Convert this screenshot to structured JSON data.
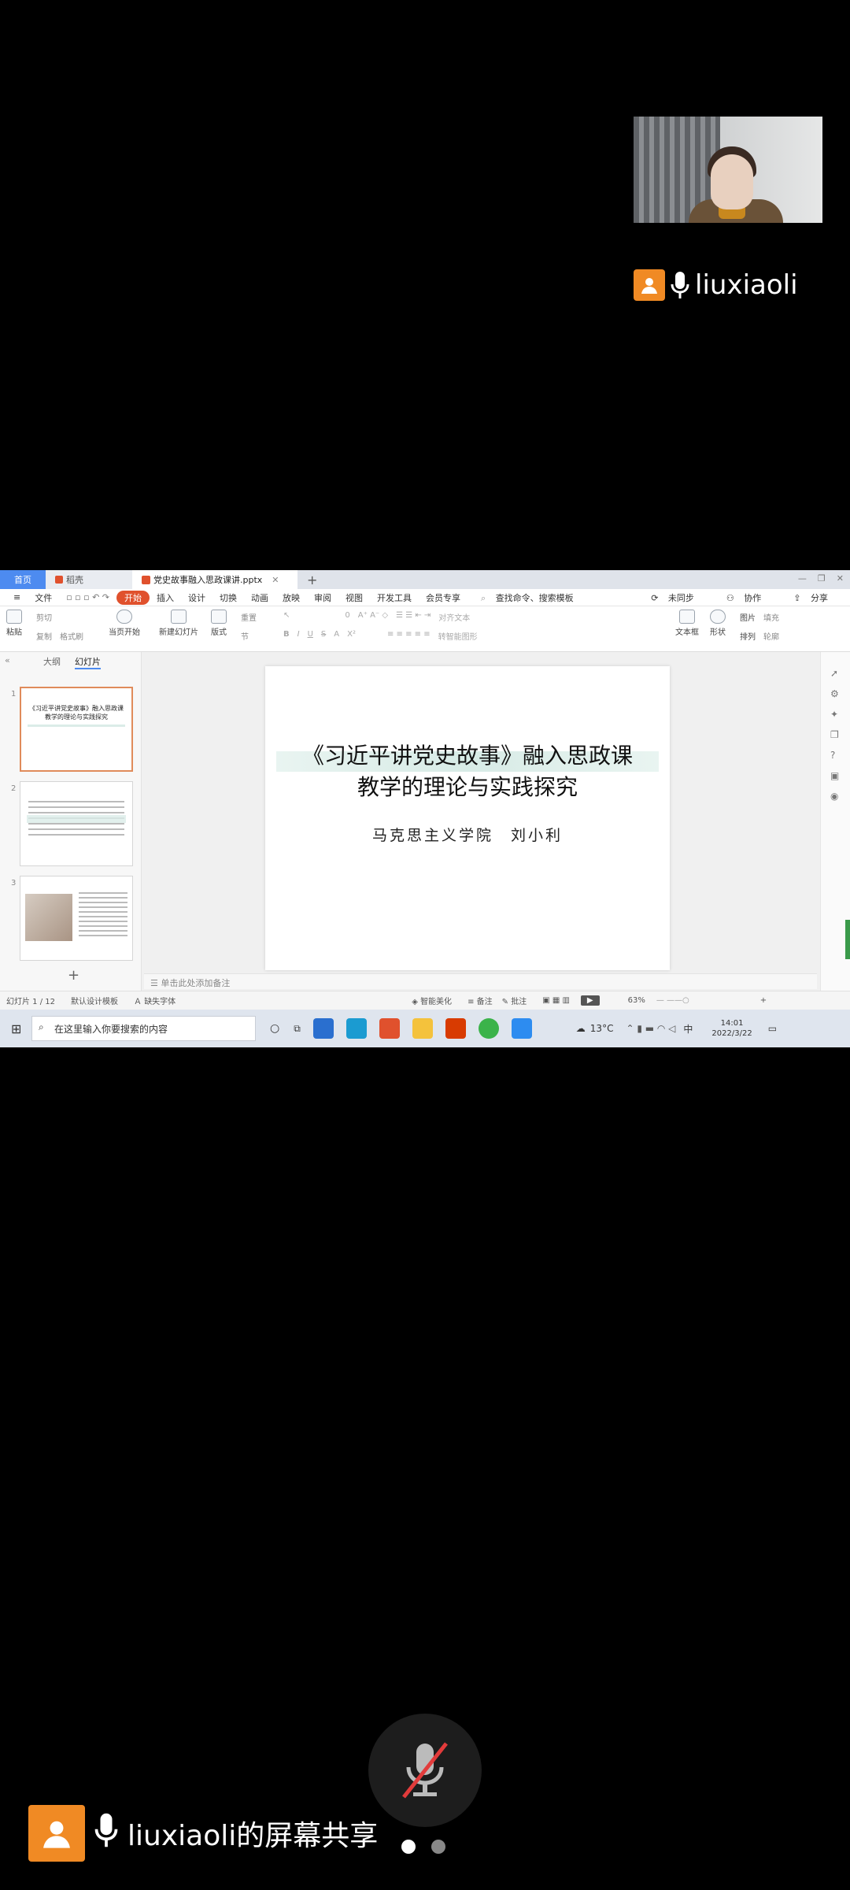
{
  "speaker": {
    "name": "liuxiaoli"
  },
  "tabs": [
    {
      "label": "首页"
    },
    {
      "label": "稻壳"
    },
    {
      "label": "党史故事融入思政课讲.pptx"
    }
  ],
  "menu": {
    "file": "文件",
    "items": [
      "开始",
      "插入",
      "设计",
      "切换",
      "动画",
      "放映",
      "审阅",
      "视图",
      "开发工具",
      "会员专享"
    ],
    "search": "查找命令、搜索模板",
    "sync": "未同步",
    "collab": "协作",
    "share": "分享"
  },
  "ribbon": {
    "paste": "粘贴",
    "cut": "剪切",
    "copy": "复制",
    "format_painter": "格式刷",
    "play_from": "当页开始",
    "new_slide": "新建幻灯片",
    "layout": "版式",
    "section": "节",
    "reset": "重置",
    "text_box": "文本框",
    "shape": "形状",
    "picture": "图片",
    "arrange": "排列",
    "fill": "填充",
    "outline": "轮廓",
    "align_text": "对齐文本",
    "smart_art": "转智能图形",
    "font_size": "0"
  },
  "pane": {
    "tab_outline": "大纲",
    "tab_slides": "幻灯片",
    "add": "+"
  },
  "thumbs": [
    {
      "num": "1",
      "title": "《习近平讲党史故事》融入思政课教学的理论与实践探究"
    },
    {
      "num": "2"
    },
    {
      "num": "3"
    }
  ],
  "slide": {
    "title_line1": "《习近平讲党史故事》融入思政课",
    "title_line2": "教学的理论与实践探究",
    "subtitle": "马克思主义学院　刘小利"
  },
  "notes_placeholder": "单击此处添加备注",
  "status": {
    "slide_count": "幻灯片 1 / 12",
    "template": "默认设计模板",
    "missing_font": "缺失字体",
    "beautify": "智能美化",
    "notes": "备注",
    "comments": "批注",
    "zoom": "63%"
  },
  "taskbar": {
    "search_placeholder": "在这里输入你要搜索的内容",
    "weather": "13°C",
    "ime": "中",
    "time": "14:01",
    "date": "2022/3/22"
  },
  "bottom": {
    "share_label": "liuxiaoli的屏幕共享"
  },
  "colors": {
    "accent": "#4d8bf0",
    "start_tab": "#e0512d",
    "avatar": "#f08a24"
  }
}
